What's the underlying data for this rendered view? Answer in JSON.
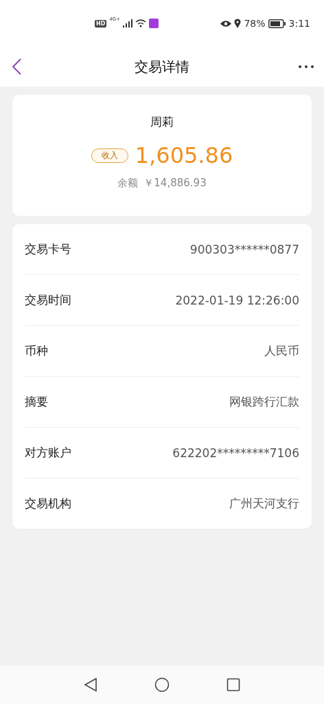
{
  "status_bar": {
    "hd": "HD",
    "network": "4G+",
    "battery": "78%",
    "time": "3:11"
  },
  "header": {
    "title": "交易详情"
  },
  "summary": {
    "name": "周莉",
    "tag": "收入",
    "amount": "1,605.86",
    "balance_label": "余额",
    "balance": "￥14,886.93"
  },
  "details": [
    {
      "label": "交易卡号",
      "value": "900303******0877"
    },
    {
      "label": "交易时间",
      "value": "2022-01-19 12:26:00"
    },
    {
      "label": "币种",
      "value": "人民币"
    },
    {
      "label": "摘要",
      "value": "网银跨行汇款"
    },
    {
      "label": "对方账户",
      "value": "622202*********7106"
    },
    {
      "label": "交易机构",
      "value": "广州天河支行"
    }
  ]
}
